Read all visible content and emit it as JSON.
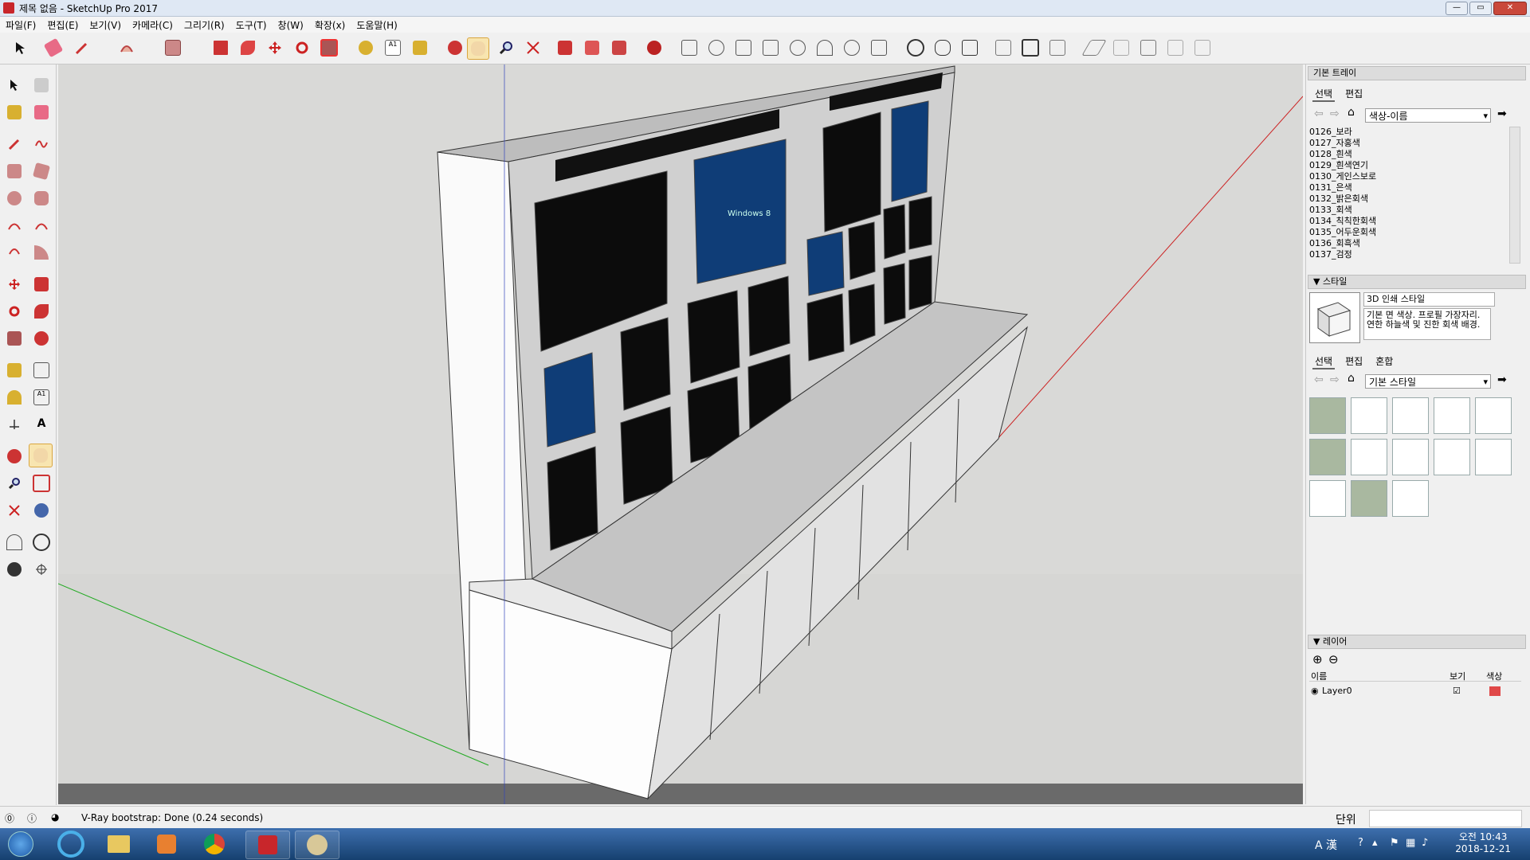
{
  "window": {
    "title": "제목 없음 - SketchUp Pro 2017",
    "min": "—",
    "max": "▭",
    "close": "✕"
  },
  "menu": [
    "파일(F)",
    "편집(E)",
    "보기(V)",
    "카메라(C)",
    "그리기(R)",
    "도구(T)",
    "창(W)",
    "확장(x)",
    "도움말(H)"
  ],
  "tray": {
    "title": "기본 트레이",
    "materials": {
      "tabs": [
        "선택",
        "편집"
      ],
      "dropdown": "색상-이름",
      "items": [
        "0126_보라",
        "0127_자홍색",
        "0128_흰색",
        "0129_흰색연기",
        "0130_게인스보로",
        "0131_은색",
        "0132_밝은회색",
        "0133_회색",
        "0134_칙칙한회색",
        "0135_어두운회색",
        "0136_회흑색",
        "0137_검정"
      ]
    },
    "styles": {
      "header": "스타일",
      "name": "3D 인쇄 스타일",
      "description": "기본 면 색상. 프로필 가장자리. 연한 하늘색 및 진한 회색 배경.",
      "tabs": [
        "선택",
        "편집",
        "혼합"
      ],
      "dropdown": "기본 스타일"
    },
    "layers": {
      "header": "레이어",
      "col_name": "이름",
      "col_visible": "보기",
      "col_color": "색상",
      "layer_name": "Layer0",
      "layer_color": "#e04848"
    }
  },
  "status": {
    "message": "V-Ray bootstrap: Done (0.24 seconds)",
    "units_label": "단위"
  },
  "taskbar": {
    "time": "오전 10:43",
    "date": "2018-12-21",
    "ime": "A 漢"
  },
  "screen_text": {
    "windows_logo_text": "Windows 8"
  },
  "colors": {
    "accent": "#d9a640",
    "axis_red": "#cc2222",
    "axis_green": "#22aa22",
    "axis_blue": "#2222cc"
  }
}
